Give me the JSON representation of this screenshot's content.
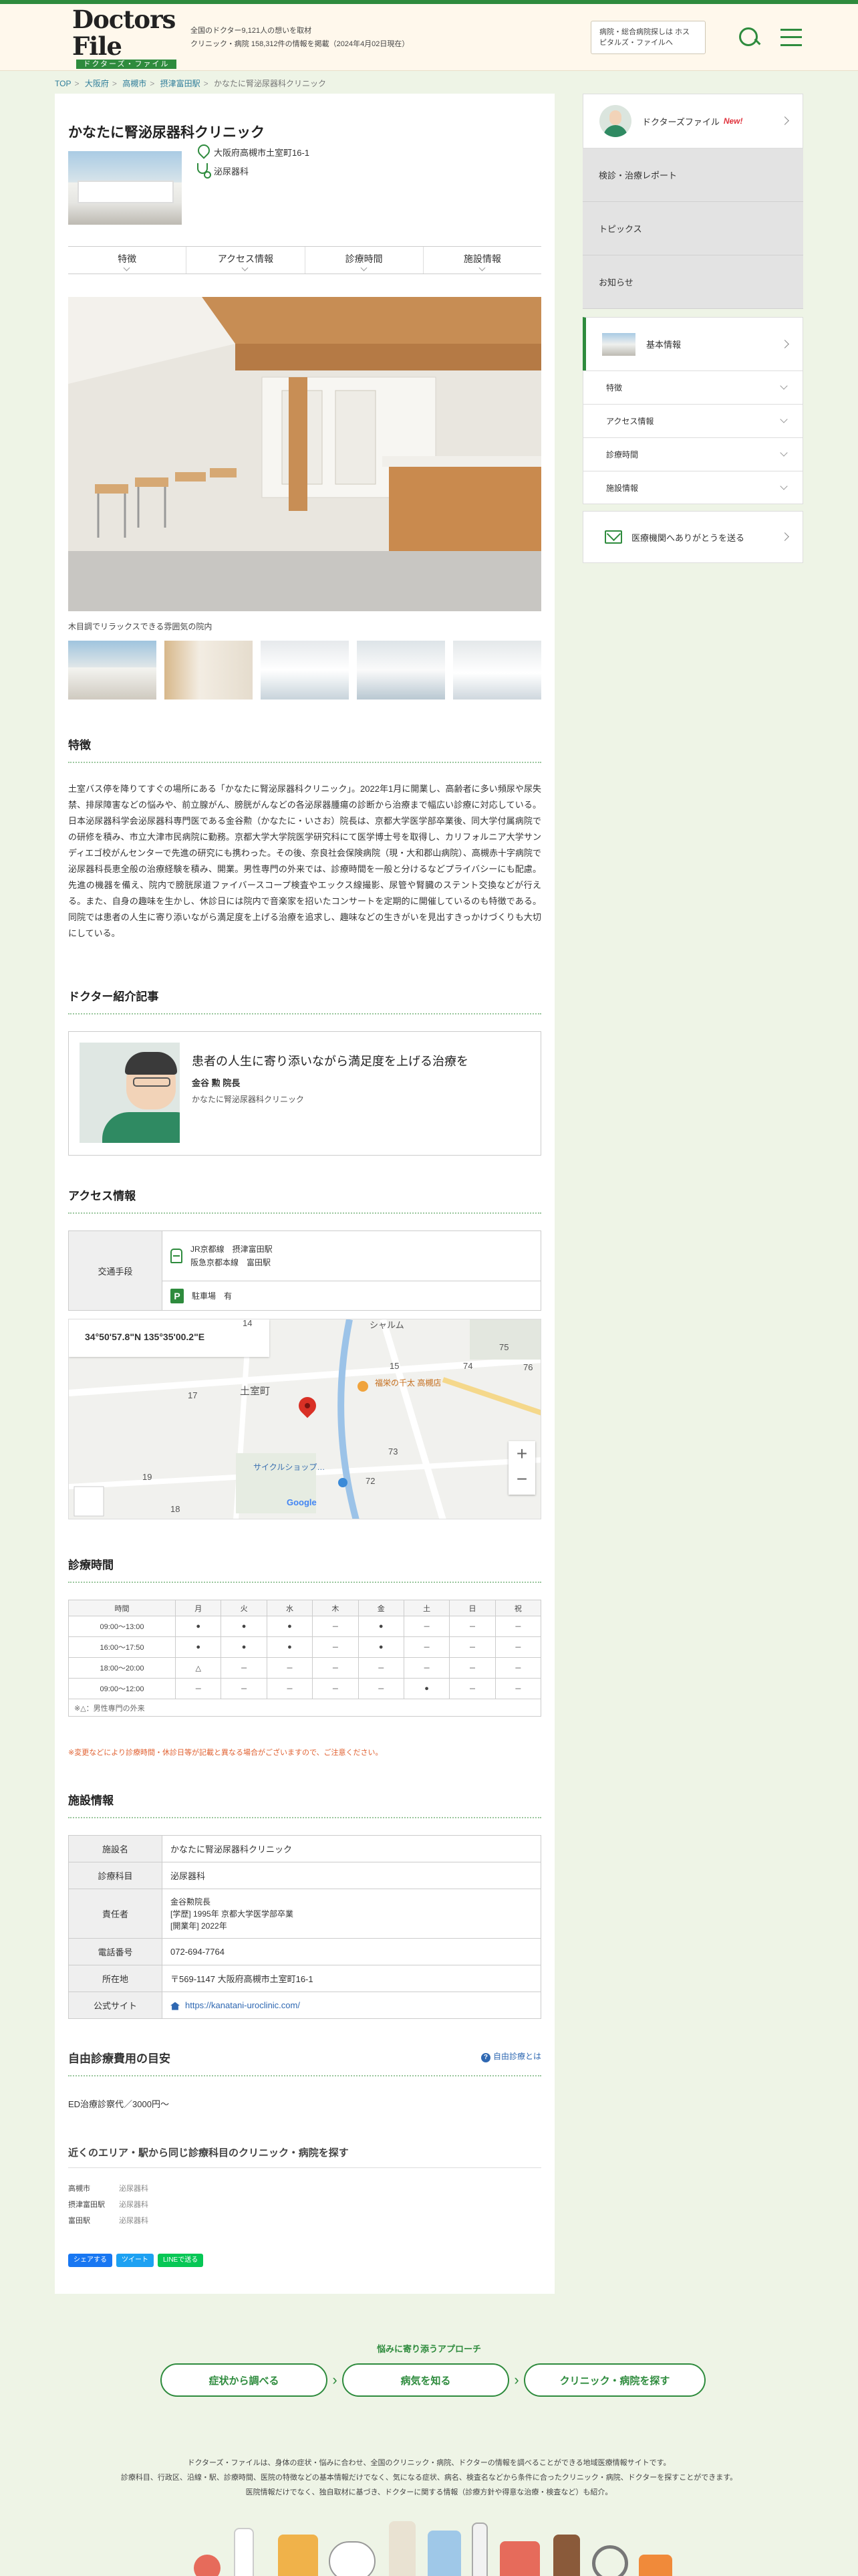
{
  "header": {
    "logo": "Doctors File",
    "logo_sub": "ドクターズ・ファイル",
    "tagline1": "全国のドクター9,121人の想いを取材",
    "tagline2": "クリニック・病院 158,312件の情報を掲載（2024年4月02日現在）",
    "hospital_btn": "病院・総合病院探しは ホスピタルズ・ファイルへ"
  },
  "breadcrumb": [
    "TOP",
    "大阪府",
    "高槻市",
    "摂津富田駅",
    "かなたに腎泌尿器科クリニック"
  ],
  "clinic": {
    "name": "かなたに腎泌尿器科クリニック",
    "address": "大阪府高槻市土室町16-1",
    "department": "泌尿器科"
  },
  "tabs": [
    "特徴",
    "アクセス情報",
    "診療時間",
    "施設情報"
  ],
  "photo_caption": "木目調でリラックスできる雰囲気の院内",
  "sections": {
    "features": "特徴",
    "doctor": "ドクター紹介記事",
    "access": "アクセス情報",
    "hours": "診療時間",
    "facility": "施設情報",
    "fee": "自由診療費用の目安",
    "nearby": "近くのエリア・駅から同じ診療科目のクリニック・病院を探す"
  },
  "feature_text": "土室バス停を降りてすぐの場所にある「かなたに腎泌尿器科クリニック」。2022年1月に開業し、高齢者に多い頻尿や尿失禁、排尿障害などの悩みや、前立腺がん、膀胱がんなどの各泌尿器腫瘍の診断から治療まで幅広い診療に対応している。日本泌尿器科学会泌尿器科専門医である金谷勲（かなたに・いさお）院長は、京都大学医学部卒業後、同大学付属病院での研修を積み、市立大津市民病院に勤務。京都大学大学院医学研究科にて医学博士号を取得し、カリフォルニア大学サンディエゴ校がんセンターで先進の研究にも携わった。その後、奈良社会保険病院（現・大和郡山病院）、高槻赤十字病院で泌尿器科長恵全般の治療経験を積み、開業。男性専門の外来では、診療時間を一般と分けるなどプライバシーにも配慮。先進の機器を備え、院内で膀胱尿道ファイバースコープ検査やエックス線撮影、尿管や腎臓のステント交換などが行える。また、自身の趣味を生かし、休診日には院内で音楽家を招いたコンサートを定期的に開催しているのも特徴である。同院では患者の人生に寄り添いながら満足度を上げる治療を追求し、趣味などの生きがいを見出すきっかけづくりも大切にしている。",
  "doctor": {
    "title": "患者の人生に寄り添いながら満足度を上げる治療を",
    "name": "金谷 勲 院長",
    "clinic": "かなたに腎泌尿器科クリニック"
  },
  "access": {
    "label": "交通手段",
    "train1": "JR京都線　摂津富田駅",
    "train2": "阪急京都本線　富田駅",
    "parking": "駐車場　有"
  },
  "map": {
    "coord": "34°50'57.8\"N 135°35'00.2\"E",
    "place": "土室町",
    "bank": "福栄の千太 高槻店",
    "shop": "サイクルショップ…",
    "google": "Google",
    "labels": [
      "14",
      "15",
      "17",
      "19",
      "18",
      "73",
      "72",
      "74",
      "75",
      "76",
      "シャルム"
    ]
  },
  "hours_table": {
    "head": [
      "時間",
      "月",
      "火",
      "水",
      "木",
      "金",
      "土",
      "日",
      "祝"
    ],
    "rows": [
      [
        "09:00〜13:00",
        "●",
        "●",
        "●",
        "－",
        "●",
        "－",
        "－",
        "－"
      ],
      [
        "16:00〜17:50",
        "●",
        "●",
        "●",
        "－",
        "●",
        "－",
        "－",
        "－"
      ],
      [
        "18:00〜20:00",
        "△",
        "－",
        "－",
        "－",
        "－",
        "－",
        "－",
        "－"
      ],
      [
        "09:00〜12:00",
        "－",
        "－",
        "－",
        "－",
        "－",
        "●",
        "－",
        "－"
      ]
    ],
    "note": "※△：男性専門の外来",
    "warning": "※変更などにより診療時間・休診日等が記載と異なる場合がございますので、ご注意ください。"
  },
  "facility": [
    {
      "k": "施設名",
      "v": "かなたに腎泌尿器科クリニック"
    },
    {
      "k": "診療科目",
      "v": "泌尿器科"
    },
    {
      "k": "責任者",
      "v": "金谷勲院長\n[学歴] 1995年 京都大学医学部卒業\n[開業年] 2022年"
    },
    {
      "k": "電話番号",
      "v": "072-694-7764"
    },
    {
      "k": "所在地",
      "v": "〒569-1147 大阪府高槻市土室町16-1"
    },
    {
      "k": "公式サイト",
      "v": "https://kanatani-uroclinic.com/"
    }
  ],
  "fee": {
    "link": "自由診療とは",
    "text": "ED治療診察代／3000円〜"
  },
  "nearby": [
    {
      "area": "高槻市",
      "dept": "泌尿器科"
    },
    {
      "area": "摂津富田駅",
      "dept": "泌尿器科"
    },
    {
      "area": "富田駅",
      "dept": "泌尿器科"
    }
  ],
  "share": {
    "fb": "シェアする",
    "tw": "ツイート",
    "line": "LINEで送る"
  },
  "sidebar": {
    "doctors_file": "ドクターズファイル",
    "new": "New!",
    "report": "検診・治療レポート",
    "topics": "トピックス",
    "news": "お知らせ",
    "basic": "基本情報",
    "subs": [
      "特徴",
      "アクセス情報",
      "診療時間",
      "施設情報"
    ],
    "thanks": "医療機関へありがとうを送る"
  },
  "footer": {
    "approach": "悩みに寄り添うアプローチ",
    "btn1": "症状から調べる",
    "btn2": "病気を知る",
    "btn3": "クリニック・病院を探す",
    "text1": "ドクターズ・ファイルは、身体の症状・悩みに合わせ、全国のクリニック・病院、ドクターの情報を調べることができる地域医療情報サイトです。",
    "text2": "診療科目、行政区、沿線・駅、診療時間、医院の特徴などの基本情報だけでなく、気になる症状、病名、検査名などから条件に合ったクリニック・病院、ドクターを探すことができます。",
    "text3": "医院情報だけでなく、独自取材に基づき、ドクターに関する情報（診療方針や得意な治療・検査など）も紹介。"
  },
  "colors": {
    "brand": "#2e8b3d",
    "link": "#2f68b2",
    "warning": "#e06030",
    "background": "#eef4e6"
  }
}
